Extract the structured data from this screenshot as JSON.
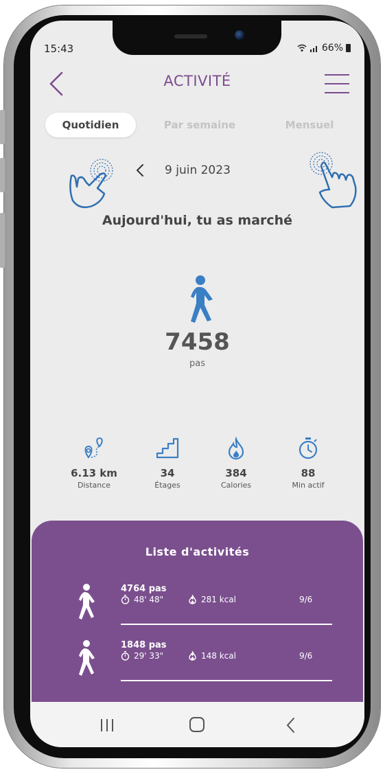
{
  "status_bar": {
    "time": "15:43",
    "battery_text": "66%"
  },
  "header": {
    "title": "ACTIVITÉ"
  },
  "tabs": [
    {
      "label": "Quotidien",
      "active": true
    },
    {
      "label": "Par semaine",
      "active": false
    },
    {
      "label": "Mensuel",
      "active": false
    }
  ],
  "date_nav": {
    "date": "9 juin 2023"
  },
  "summary": {
    "headline": "Aujourd'hui, tu as marché",
    "steps": "7458",
    "steps_unit": "pas"
  },
  "stats": [
    {
      "icon": "distance-icon",
      "value": "6.13 km",
      "label": "Distance"
    },
    {
      "icon": "stairs-icon",
      "value": "34",
      "label": "Étages"
    },
    {
      "icon": "flame-icon",
      "value": "384",
      "label": "Calories"
    },
    {
      "icon": "stopwatch-icon",
      "value": "88",
      "label": "Min actif"
    }
  ],
  "activities": {
    "title": "Liste d'activités",
    "items": [
      {
        "steps": "4764 pas",
        "duration": "48' 48\"",
        "kcal": "281 kcal",
        "date": "9/6"
      },
      {
        "steps": "1848 pas",
        "duration": "29' 33\"",
        "kcal": "148 kcal",
        "date": "9/6"
      }
    ]
  },
  "colors": {
    "accent": "#7b4f8e",
    "icon_blue": "#3a7fc4"
  }
}
